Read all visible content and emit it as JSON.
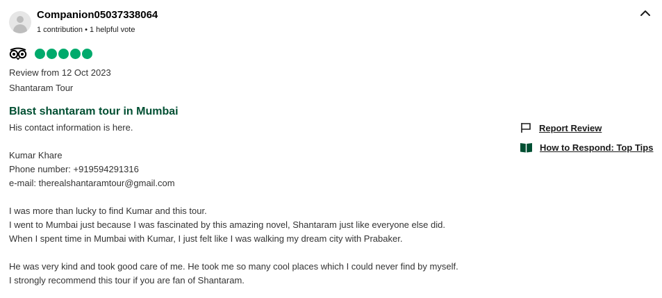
{
  "reviewer": {
    "name": "Companion05037338064",
    "meta": "1 contribution • 1 helpful vote"
  },
  "rating": {
    "value": 5,
    "max": 5,
    "accent": "#00aa6c"
  },
  "review": {
    "date": "Review from 12 Oct 2023",
    "tour": "Shantaram Tour",
    "title": "Blast shantaram tour in Mumbai",
    "lines": [
      "His contact information is here.",
      "",
      "Kumar Khare",
      "Phone number: +919594291316",
      "e-mail: therealshantaramtour@gmail.com",
      "",
      "I was more than lucky to find Kumar and this tour.",
      "I went to Mumbai just because I was fascinated by this amazing novel, Shantaram just like everyone else did.",
      "When I spent time in Mumbai with Kumar, I just felt like I was walking my dream city with Prabaker.",
      "",
      "He was very kind and took good care of me. He took me so many cool places which I could never find by myself.",
      "I strongly recommend this tour if you are fan of Shantaram."
    ]
  },
  "actions": {
    "report": "Report Review",
    "respond": "How to Respond: Top Tips"
  },
  "icons": {
    "collapse": "chevron-up-icon",
    "brand": "tripadvisor-owl-icon",
    "report": "flag-icon",
    "respond": "book-icon"
  }
}
